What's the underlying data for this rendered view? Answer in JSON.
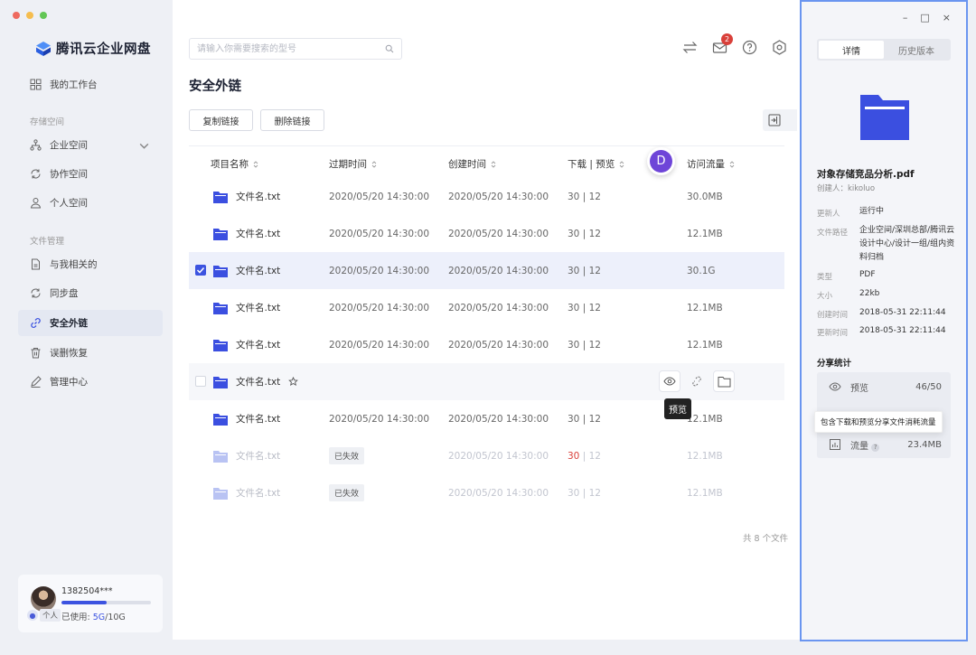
{
  "app": {
    "name": "腾讯云企业网盘"
  },
  "sidebar": {
    "workspace": "我的工作台",
    "storage_section": "存储空间",
    "storage_items": [
      "企业空间",
      "协作空间",
      "个人空间"
    ],
    "file_section": "文件管理",
    "file_items": [
      "与我相关的",
      "同步盘",
      "安全外链",
      "误删恢复",
      "管理中心"
    ],
    "active_item": "安全外链"
  },
  "user": {
    "phone": "1382504***",
    "badge": "个人",
    "usage_prefix": "已使用: ",
    "usage_used": "5G",
    "usage_total": "/10G",
    "usage_fraction": 0.5
  },
  "search": {
    "placeholder": "请输入你需要搜索的型号"
  },
  "notifications": {
    "count": "2"
  },
  "page": {
    "title": "安全外链"
  },
  "toolbar": {
    "copy_link": "复制链接",
    "delete_link": "删除链接"
  },
  "table": {
    "headers": {
      "name": "项目名称",
      "expire": "过期时间",
      "created": "创建时间",
      "dl_preview": "下载 | 预览",
      "traffic": "访问流量"
    },
    "rows": [
      {
        "name": "文件名.txt",
        "expire": "2020/05/20 14:30:00",
        "created": "2020/05/20 14:30:00",
        "dl": "30",
        "preview": "12",
        "traffic": "30.0MB",
        "state": "normal"
      },
      {
        "name": "文件名.txt",
        "expire": "2020/05/20 14:30:00",
        "created": "2020/05/20 14:30:00",
        "dl": "30",
        "preview": "12",
        "traffic": "12.1MB",
        "state": "normal"
      },
      {
        "name": "文件名.txt",
        "expire": "2020/05/20 14:30:00",
        "created": "2020/05/20 14:30:00",
        "dl": "30",
        "preview": "12",
        "traffic": "30.1G",
        "state": "selected"
      },
      {
        "name": "文件名.txt",
        "expire": "2020/05/20 14:30:00",
        "created": "2020/05/20 14:30:00",
        "dl": "30",
        "preview": "12",
        "traffic": "12.1MB",
        "state": "normal"
      },
      {
        "name": "文件名.txt",
        "expire": "2020/05/20 14:30:00",
        "created": "2020/05/20 14:30:00",
        "dl": "30",
        "preview": "12",
        "traffic": "12.1MB",
        "state": "normal"
      },
      {
        "name": "文件名.txt",
        "expire": "",
        "created": "",
        "dl": "",
        "preview": "",
        "traffic": "",
        "state": "hover"
      },
      {
        "name": "文件名.txt",
        "expire": "2020/05/20 14:30:00",
        "created": "2020/05/20 14:30:00",
        "dl": "30",
        "preview": "12",
        "traffic": "12.1MB",
        "state": "normal"
      },
      {
        "name": "文件名.txt",
        "expire": "已失效",
        "created": "2020/05/20 14:30:00",
        "dl": "30",
        "preview": "12",
        "traffic": "12.1MB",
        "state": "expired",
        "dl_alert": true
      },
      {
        "name": "文件名.txt",
        "expire": "已失效",
        "created": "2020/05/20 14:30:00",
        "dl": "30",
        "preview": "12",
        "traffic": "12.1MB",
        "state": "expired"
      }
    ],
    "hover_tooltip": "预览",
    "file_count": "共 8 个文件",
    "collaborator_initial": "D"
  },
  "panel": {
    "tabs": [
      "详情",
      "历史版本"
    ],
    "active_tab": "详情",
    "file_name": "对象存储竞品分析.pdf",
    "creator": "创建人：kikoluo",
    "meta": [
      {
        "label": "更新人",
        "value": "运行中"
      },
      {
        "label": "文件路径",
        "value": "企业空间/深圳总部/腾讯云设计中心/设计一组/组内资料归档"
      },
      {
        "label": "类型",
        "value": "PDF"
      },
      {
        "label": "大小",
        "value": "22kb"
      },
      {
        "label": "创建时间",
        "value": "2018-05-31 22:11:44"
      },
      {
        "label": "更新时间",
        "value": "2018-05-31 22:11:44"
      }
    ],
    "share_title": "分享统计",
    "stats": [
      {
        "label": "预览",
        "value": "46/50",
        "icon": "eye-icon"
      },
      {
        "label": "流量",
        "value": "23.4MB",
        "icon": "chart-icon"
      }
    ],
    "traffic_tooltip": "包含下载和预览分享文件消耗流量"
  },
  "colors": {
    "accent": "#3c53e0",
    "folder": "#3b4fe0",
    "panel_border": "#6a95f0",
    "alert": "#d9403a"
  }
}
